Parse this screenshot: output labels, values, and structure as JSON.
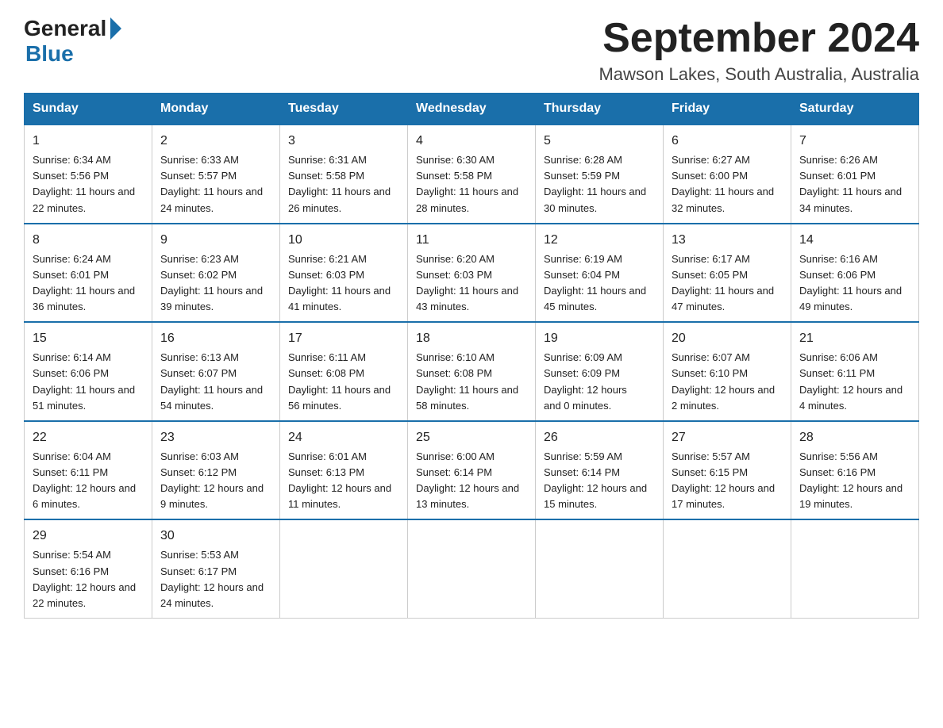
{
  "header": {
    "logo_general": "General",
    "logo_blue": "Blue",
    "month_title": "September 2024",
    "location": "Mawson Lakes, South Australia, Australia"
  },
  "days_of_week": [
    "Sunday",
    "Monday",
    "Tuesday",
    "Wednesday",
    "Thursday",
    "Friday",
    "Saturday"
  ],
  "weeks": [
    [
      {
        "day": "1",
        "sunrise": "6:34 AM",
        "sunset": "5:56 PM",
        "daylight": "11 hours and 22 minutes."
      },
      {
        "day": "2",
        "sunrise": "6:33 AM",
        "sunset": "5:57 PM",
        "daylight": "11 hours and 24 minutes."
      },
      {
        "day": "3",
        "sunrise": "6:31 AM",
        "sunset": "5:58 PM",
        "daylight": "11 hours and 26 minutes."
      },
      {
        "day": "4",
        "sunrise": "6:30 AM",
        "sunset": "5:58 PM",
        "daylight": "11 hours and 28 minutes."
      },
      {
        "day": "5",
        "sunrise": "6:28 AM",
        "sunset": "5:59 PM",
        "daylight": "11 hours and 30 minutes."
      },
      {
        "day": "6",
        "sunrise": "6:27 AM",
        "sunset": "6:00 PM",
        "daylight": "11 hours and 32 minutes."
      },
      {
        "day": "7",
        "sunrise": "6:26 AM",
        "sunset": "6:01 PM",
        "daylight": "11 hours and 34 minutes."
      }
    ],
    [
      {
        "day": "8",
        "sunrise": "6:24 AM",
        "sunset": "6:01 PM",
        "daylight": "11 hours and 36 minutes."
      },
      {
        "day": "9",
        "sunrise": "6:23 AM",
        "sunset": "6:02 PM",
        "daylight": "11 hours and 39 minutes."
      },
      {
        "day": "10",
        "sunrise": "6:21 AM",
        "sunset": "6:03 PM",
        "daylight": "11 hours and 41 minutes."
      },
      {
        "day": "11",
        "sunrise": "6:20 AM",
        "sunset": "6:03 PM",
        "daylight": "11 hours and 43 minutes."
      },
      {
        "day": "12",
        "sunrise": "6:19 AM",
        "sunset": "6:04 PM",
        "daylight": "11 hours and 45 minutes."
      },
      {
        "day": "13",
        "sunrise": "6:17 AM",
        "sunset": "6:05 PM",
        "daylight": "11 hours and 47 minutes."
      },
      {
        "day": "14",
        "sunrise": "6:16 AM",
        "sunset": "6:06 PM",
        "daylight": "11 hours and 49 minutes."
      }
    ],
    [
      {
        "day": "15",
        "sunrise": "6:14 AM",
        "sunset": "6:06 PM",
        "daylight": "11 hours and 51 minutes."
      },
      {
        "day": "16",
        "sunrise": "6:13 AM",
        "sunset": "6:07 PM",
        "daylight": "11 hours and 54 minutes."
      },
      {
        "day": "17",
        "sunrise": "6:11 AM",
        "sunset": "6:08 PM",
        "daylight": "11 hours and 56 minutes."
      },
      {
        "day": "18",
        "sunrise": "6:10 AM",
        "sunset": "6:08 PM",
        "daylight": "11 hours and 58 minutes."
      },
      {
        "day": "19",
        "sunrise": "6:09 AM",
        "sunset": "6:09 PM",
        "daylight": "12 hours and 0 minutes."
      },
      {
        "day": "20",
        "sunrise": "6:07 AM",
        "sunset": "6:10 PM",
        "daylight": "12 hours and 2 minutes."
      },
      {
        "day": "21",
        "sunrise": "6:06 AM",
        "sunset": "6:11 PM",
        "daylight": "12 hours and 4 minutes."
      }
    ],
    [
      {
        "day": "22",
        "sunrise": "6:04 AM",
        "sunset": "6:11 PM",
        "daylight": "12 hours and 6 minutes."
      },
      {
        "day": "23",
        "sunrise": "6:03 AM",
        "sunset": "6:12 PM",
        "daylight": "12 hours and 9 minutes."
      },
      {
        "day": "24",
        "sunrise": "6:01 AM",
        "sunset": "6:13 PM",
        "daylight": "12 hours and 11 minutes."
      },
      {
        "day": "25",
        "sunrise": "6:00 AM",
        "sunset": "6:14 PM",
        "daylight": "12 hours and 13 minutes."
      },
      {
        "day": "26",
        "sunrise": "5:59 AM",
        "sunset": "6:14 PM",
        "daylight": "12 hours and 15 minutes."
      },
      {
        "day": "27",
        "sunrise": "5:57 AM",
        "sunset": "6:15 PM",
        "daylight": "12 hours and 17 minutes."
      },
      {
        "day": "28",
        "sunrise": "5:56 AM",
        "sunset": "6:16 PM",
        "daylight": "12 hours and 19 minutes."
      }
    ],
    [
      {
        "day": "29",
        "sunrise": "5:54 AM",
        "sunset": "6:16 PM",
        "daylight": "12 hours and 22 minutes."
      },
      {
        "day": "30",
        "sunrise": "5:53 AM",
        "sunset": "6:17 PM",
        "daylight": "12 hours and 24 minutes."
      },
      null,
      null,
      null,
      null,
      null
    ]
  ],
  "labels": {
    "sunrise": "Sunrise:",
    "sunset": "Sunset:",
    "daylight": "Daylight:"
  }
}
